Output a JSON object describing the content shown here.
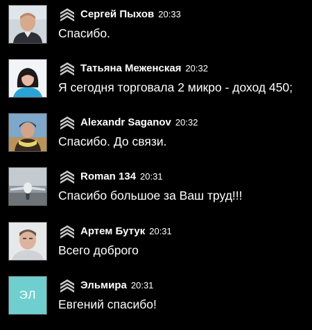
{
  "messages": [
    {
      "author": "Сергей Пыхов",
      "time": "20:33",
      "text": "Спасибо.",
      "avatar": {
        "kind": "photo",
        "icon": "avatar-photo"
      }
    },
    {
      "author": "Татьяна Меженская",
      "time": "20:32",
      "text": "Я сегодня торговала 2 микро - доход 450;",
      "avatar": {
        "kind": "photo",
        "icon": "avatar-photo"
      }
    },
    {
      "author": "Alexandr Saganov",
      "time": "20:32",
      "text": "Спасибо. До связи.",
      "avatar": {
        "kind": "photo",
        "icon": "avatar-photo"
      }
    },
    {
      "author": "Roman 134",
      "time": "20:31",
      "text": "Спасибо большое за Ваш труд!!!",
      "avatar": {
        "kind": "photo",
        "icon": "avatar-photo"
      }
    },
    {
      "author": "Артем Бутук",
      "time": "20:31",
      "text": "Всего доброго",
      "avatar": {
        "kind": "photo",
        "icon": "avatar-photo"
      }
    },
    {
      "author": "Эльмира",
      "time": "20:31",
      "text": "Евгений спасибо!",
      "avatar": {
        "kind": "initials",
        "initials": "ЭЛ",
        "color": "#6fcfcf"
      }
    }
  ],
  "rank_icon": "chevron-rank-icon",
  "colors": {
    "background": "#000000",
    "text": "#ffffff",
    "avatar_border": "#5a5a5a",
    "initials_avatar": "#6fcfcf"
  }
}
